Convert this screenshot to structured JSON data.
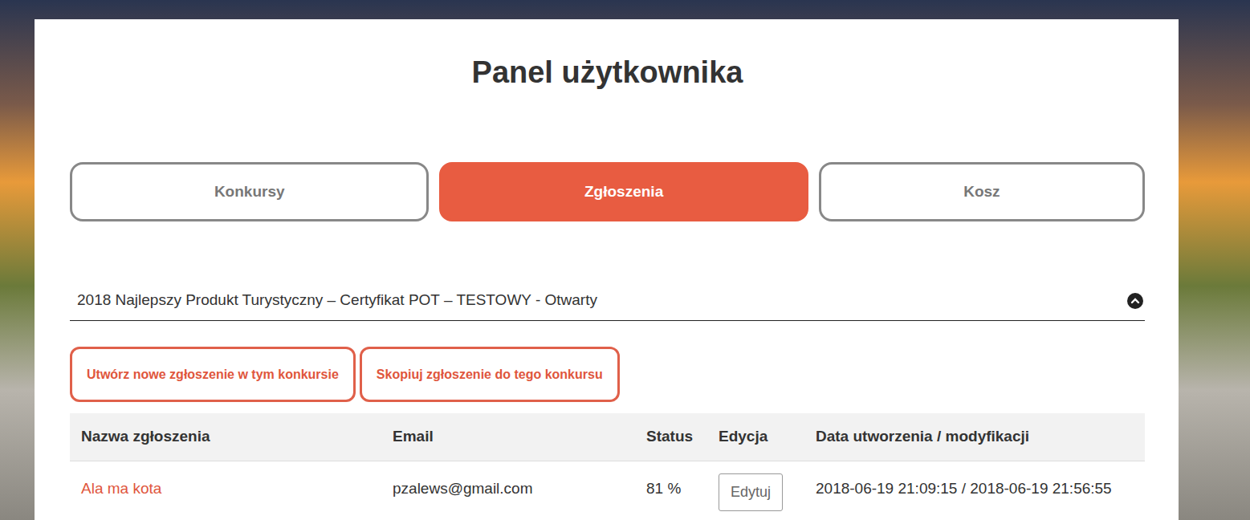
{
  "page": {
    "title": "Panel użytkownika"
  },
  "tabs": [
    {
      "label": "Konkursy",
      "selected": false
    },
    {
      "label": "Zgłoszenia",
      "selected": true
    },
    {
      "label": "Kosz",
      "selected": false
    }
  ],
  "contest": {
    "title": "2018 Najlepszy Produkt Turystyczny – Certyfikat POT – TESTOWY - Otwarty",
    "expanded": true
  },
  "actions": [
    "Utwórz nowe zgłoszenie w tym konkursie",
    "Skopiuj zgłoszenie do tego konkursu"
  ],
  "table": {
    "columns": [
      "Nazwa zgłoszenia",
      "Email",
      "Status",
      "Edycja",
      "Data utworzenia / modyfikacji"
    ],
    "rows": [
      {
        "name": "Ala ma kota",
        "email": "pzalews@gmail.com",
        "status": "81 %",
        "edit": "Edytuj",
        "dates": "2018-06-19 21:09:15 / 2018-06-19 21:56:55"
      }
    ]
  }
}
